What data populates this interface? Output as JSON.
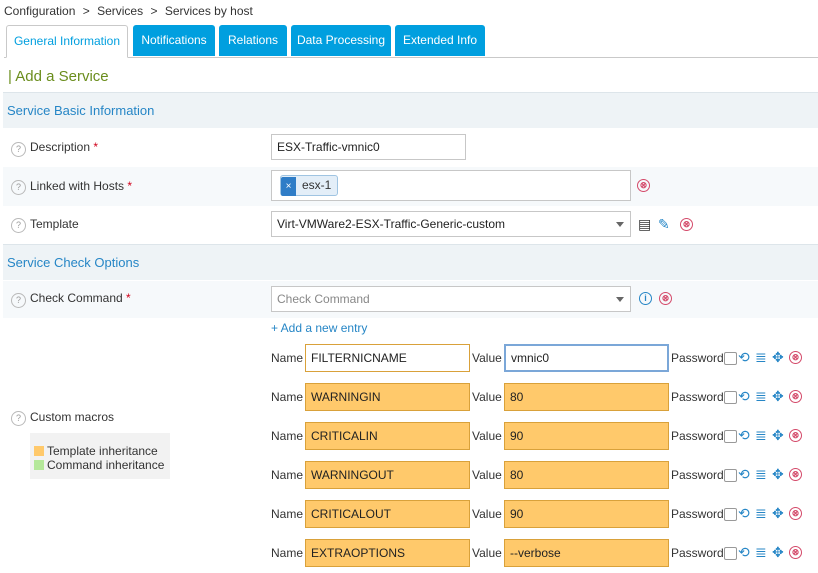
{
  "breadcrumb": {
    "items": [
      "Configuration",
      ">",
      "Services",
      ">",
      "Services by host"
    ]
  },
  "tabs": [
    "General Information",
    "Notifications",
    "Relations",
    "Data Processing",
    "Extended Info"
  ],
  "page_title": "| Add a Service",
  "sections": {
    "basic": "Service Basic Information",
    "check": "Service Check Options"
  },
  "fields": {
    "description": {
      "label": "Description",
      "required": "*",
      "value": "ESX-Traffic-vmnic0"
    },
    "linked_hosts": {
      "label": "Linked with Hosts",
      "required": "*",
      "chip_remove": "×",
      "chip": "esx-1"
    },
    "template": {
      "label": "Template",
      "value": "Virt-VMWare2-ESX-Traffic-Generic-custom"
    },
    "check_command": {
      "label": "Check Command",
      "required": "*",
      "placeholder": "Check Command"
    },
    "custom_macros": {
      "label": "Custom macros"
    }
  },
  "help_glyph": "?",
  "add_entry": "+ Add a new entry",
  "legend": {
    "template": "Template inheritance",
    "command": "Command inheritance",
    "template_color": "#ffc96b",
    "command_color": "#b5e89a"
  },
  "macro_labels": {
    "name": "Name",
    "value": "Value",
    "password": "Password"
  },
  "macros": [
    {
      "name": "FILTERNICNAME",
      "value": "vmnic0"
    },
    {
      "name": "WARNINGIN",
      "value": "80"
    },
    {
      "name": "CRITICALIN",
      "value": "90"
    },
    {
      "name": "WARNINGOUT",
      "value": "80"
    },
    {
      "name": "CRITICALOUT",
      "value": "90"
    },
    {
      "name": "EXTRAOPTIONS",
      "value": "--verbose"
    }
  ],
  "icons": {
    "delete": "⊗",
    "info": "i",
    "undo": "⟲",
    "list": "≣",
    "move": "✥",
    "edit": "✎",
    "template_view": "▤"
  }
}
